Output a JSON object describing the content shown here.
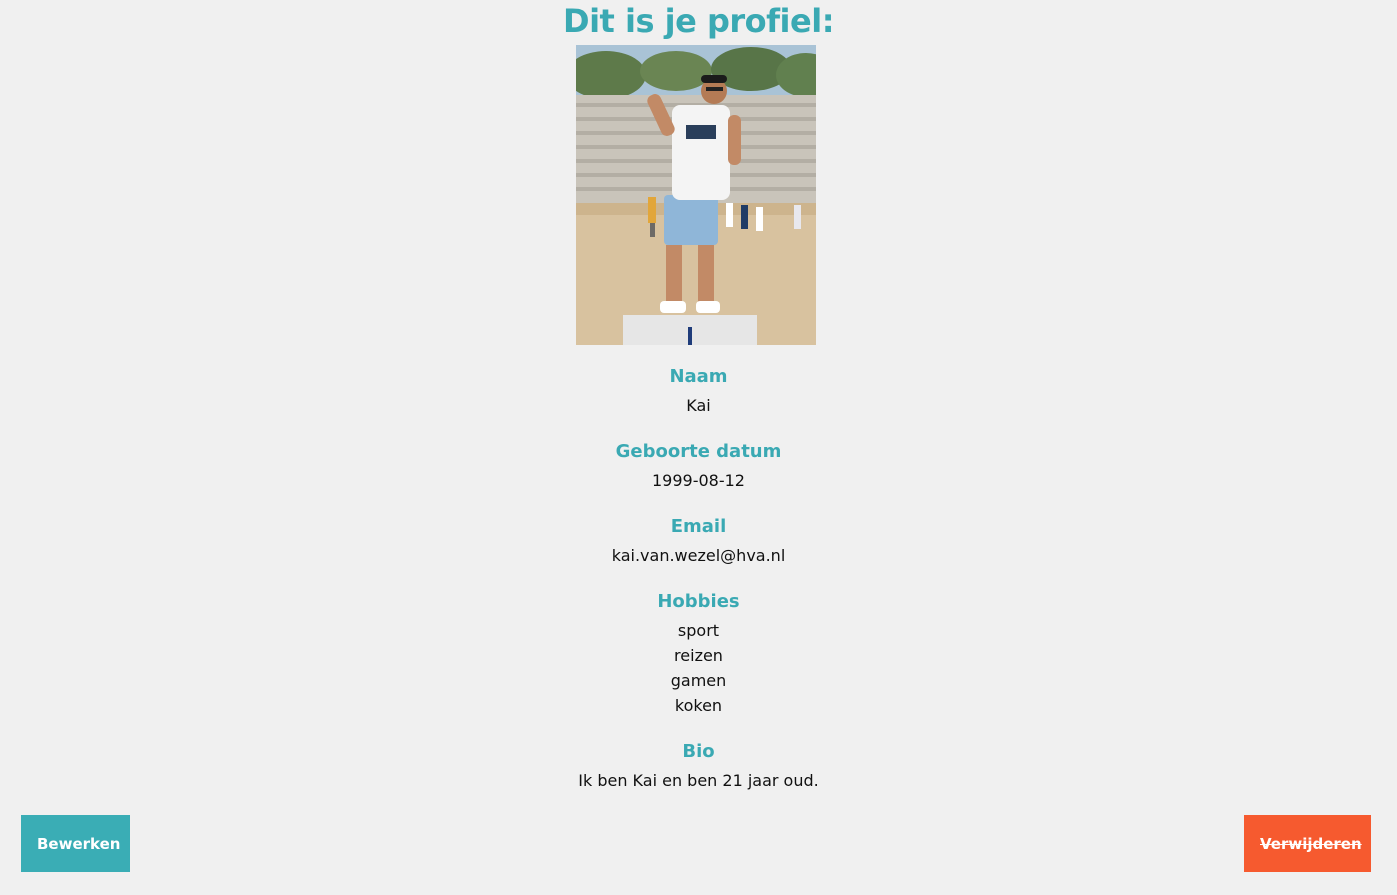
{
  "profile": {
    "title": "Dit is je profiel:",
    "photo": "profile-photo-stadium",
    "fields": {
      "name_label": "Naam",
      "name_value": "Kai",
      "birthdate_label": "Geboorte datum",
      "birthdate_value": "1999-08-12",
      "email_label": "Email",
      "email_value": "kai.van.wezel@hva.nl",
      "hobbies_label": "Hobbies",
      "hobbies": [
        "sport",
        "reizen",
        "gamen",
        "koken"
      ],
      "bio_label": "Bio",
      "bio_value": "Ik ben Kai en ben 21 jaar oud."
    }
  },
  "actions": {
    "edit_label": "Bewerken",
    "delete_label": "Verwijderen"
  },
  "colors": {
    "accent": "#3aa9b3",
    "edit_button": "#3aadb5",
    "delete_button": "#f65a2f",
    "background": "#f0f0f0"
  }
}
